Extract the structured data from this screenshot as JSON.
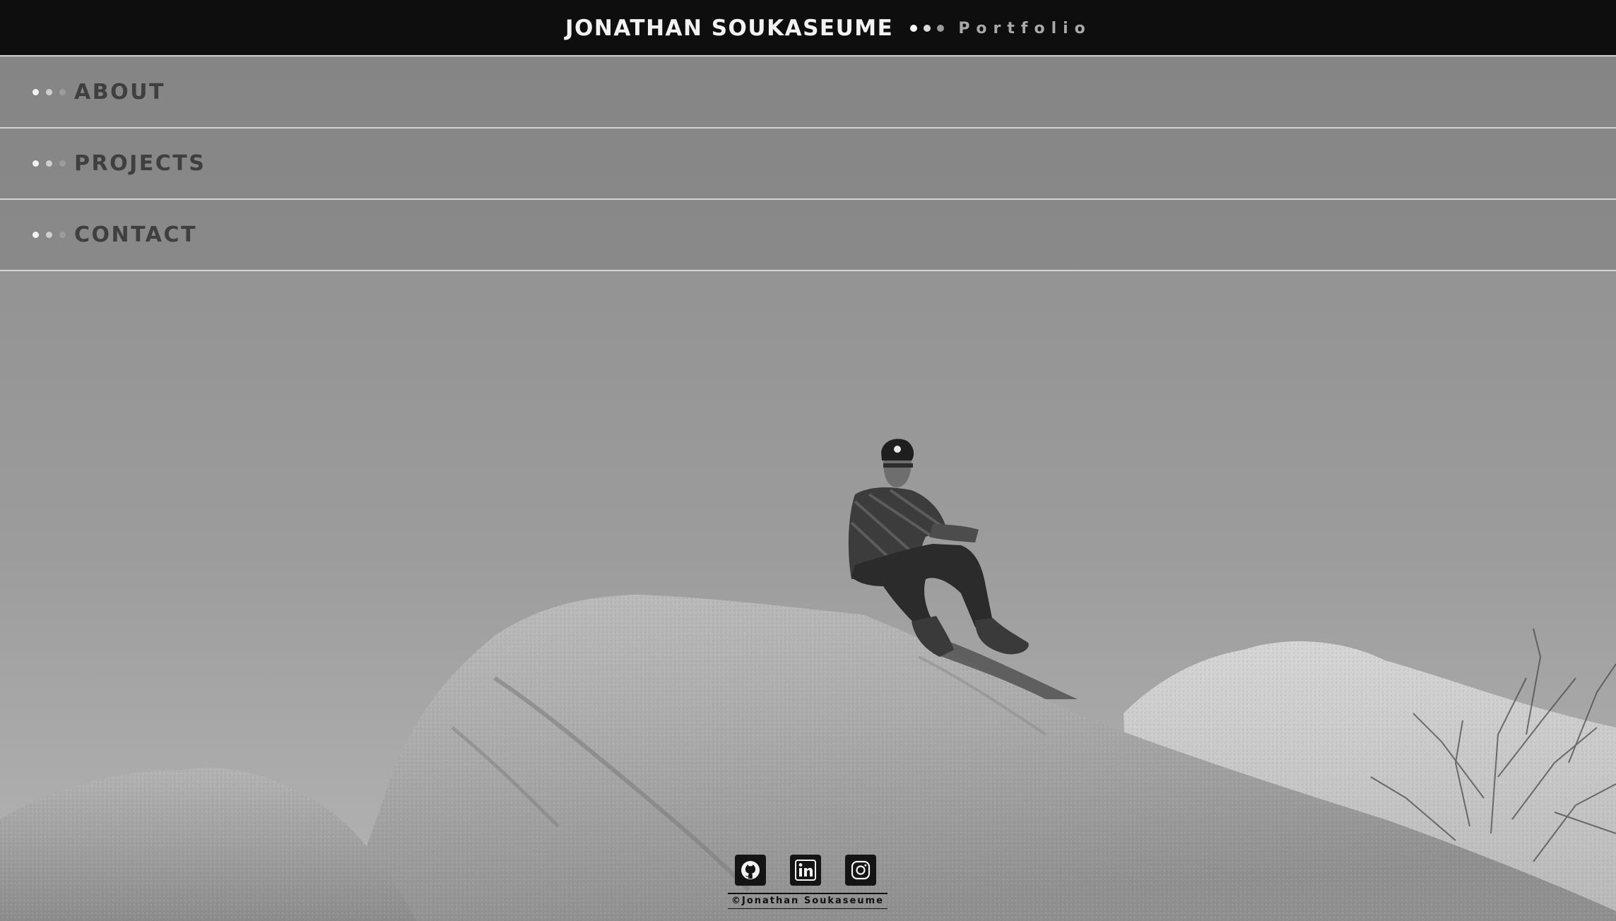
{
  "header": {
    "name": "JONATHAN SOUKASEUME",
    "subtitle": "Portfolio",
    "dot_colors": [
      "#ffffff",
      "#d9d9d9",
      "#9a9a9a"
    ]
  },
  "nav": {
    "items": [
      {
        "label": "ABOUT"
      },
      {
        "label": "PROJECTS"
      },
      {
        "label": "CONTACT"
      }
    ],
    "dot_colors": [
      "#f4f4f4",
      "#cfcfcf",
      "#9d9d9d"
    ]
  },
  "social": {
    "icons": [
      "github-icon",
      "linkedin-icon",
      "instagram-icon"
    ]
  },
  "footer": {
    "copyright": "©Jonathan Soukaseume"
  },
  "colors": {
    "header_bg": "#0e0e0e",
    "nav_text": "#3f3f3f"
  }
}
